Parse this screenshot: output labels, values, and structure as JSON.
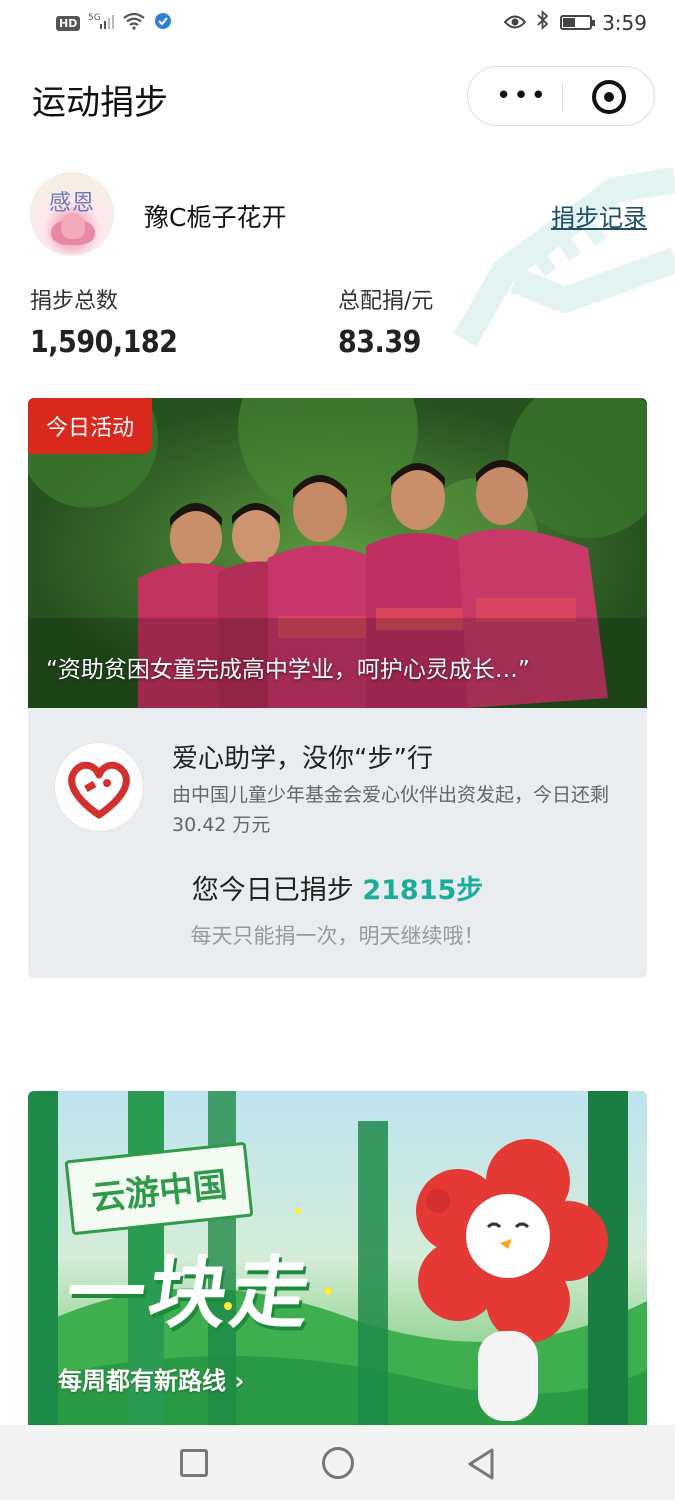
{
  "status_bar": {
    "network_badge": "HD",
    "signal_label": "5G",
    "time": "3:59",
    "battery_level": 0.45,
    "icons": [
      "signal-icon",
      "wifi-icon",
      "app-notification-icon",
      "eye-icon",
      "bluetooth-icon",
      "battery-icon"
    ]
  },
  "header": {
    "title": "运动捐步",
    "more_label": "•••"
  },
  "profile": {
    "avatar_text": "感恩",
    "username": "豫C栀子花开",
    "record_link": "捐步记录"
  },
  "stats": [
    {
      "label": "捐步总数",
      "value": "1,590,182"
    },
    {
      "label": "总配捐/元",
      "value": "83.39"
    }
  ],
  "activity": {
    "badge": "今日活动",
    "caption": "“资助贫困女童完成高中学业，呵护心灵成长…”",
    "project_title": "爱心助学，没你“步”行",
    "project_desc": "由中国儿童少年基金会爱心伙伴出资发起，今日还剩 30.42 万元",
    "today_prefix": "您今日已捐步 ",
    "today_steps": "21815步",
    "today_note": "每天只能捐一次，明天继续哦！"
  },
  "banner": {
    "tag": "云游中国",
    "headline": "一块走",
    "subtitle": "每周都有新路线 ›"
  },
  "colors": {
    "accent_green": "#1aad9a",
    "badge_red": "#d9291c",
    "link": "#1f4f64"
  }
}
